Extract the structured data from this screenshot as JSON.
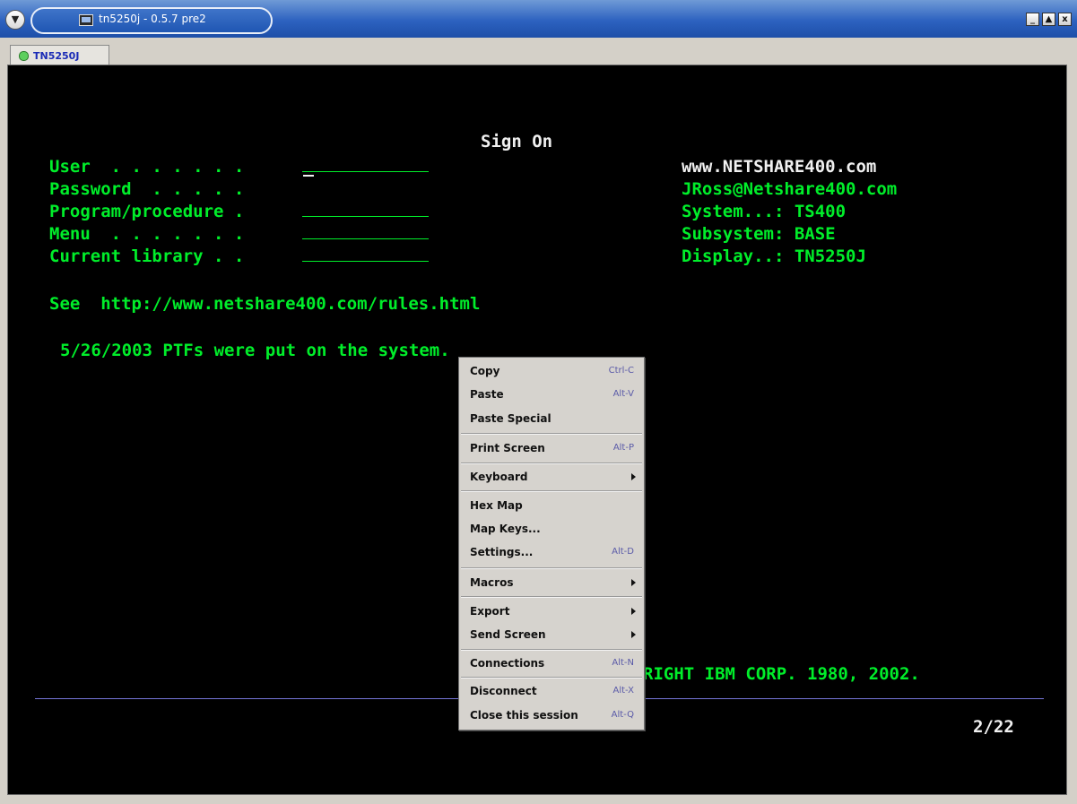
{
  "window": {
    "title": "tn5250j - 0.5.7 pre2",
    "controls": [
      "_",
      "▲",
      "x"
    ]
  },
  "tab": {
    "label": "TN5250J",
    "status_color": "#5ecf5e"
  },
  "screen": {
    "title": "Sign On",
    "fields": [
      {
        "label": "User  . . . . . . ."
      },
      {
        "label": "Password  . . . . ."
      },
      {
        "label": "Program/procedure ."
      },
      {
        "label": "Menu  . . . . . . ."
      },
      {
        "label": "Current library . ."
      }
    ],
    "info": {
      "site": "www.NETSHARE400.com",
      "email": "JRoss@Netshare400.com",
      "system": "System...: TS400",
      "subsystem": "Subsystem: BASE",
      "display": "Display..: TN5250J"
    },
    "see_line": "See  http://www.netshare400.com/rules.html",
    "notice": "5/26/2003 PTFs were put on the system.",
    "copyright": "RIGHT IBM CORP. 1980, 2002.",
    "cursor_pos": "2/22",
    "colors": {
      "text": "#00ee2a",
      "background": "#000000",
      "rule": "#7676d8"
    }
  },
  "context_menu": {
    "items": [
      {
        "label": "Copy",
        "accel": "Ctrl-C"
      },
      {
        "label": "Paste",
        "accel": "Alt-V"
      },
      {
        "label": "Paste Special",
        "accel": ""
      },
      {
        "label": "Print Screen",
        "accel": "Alt-P"
      },
      {
        "label": "Keyboard",
        "accel": ""
      },
      {
        "label": "Hex Map",
        "accel": ""
      },
      {
        "label": "Map Keys...",
        "accel": ""
      },
      {
        "label": "Settings...",
        "accel": "Alt-D"
      },
      {
        "label": "Macros",
        "accel": ""
      },
      {
        "label": "Export",
        "accel": ""
      },
      {
        "label": "Send Screen",
        "accel": ""
      },
      {
        "label": "Connections",
        "accel": "Alt-N"
      },
      {
        "label": "Disconnect",
        "accel": "Alt-X"
      },
      {
        "label": "Close this session",
        "accel": "Alt-Q"
      }
    ]
  }
}
